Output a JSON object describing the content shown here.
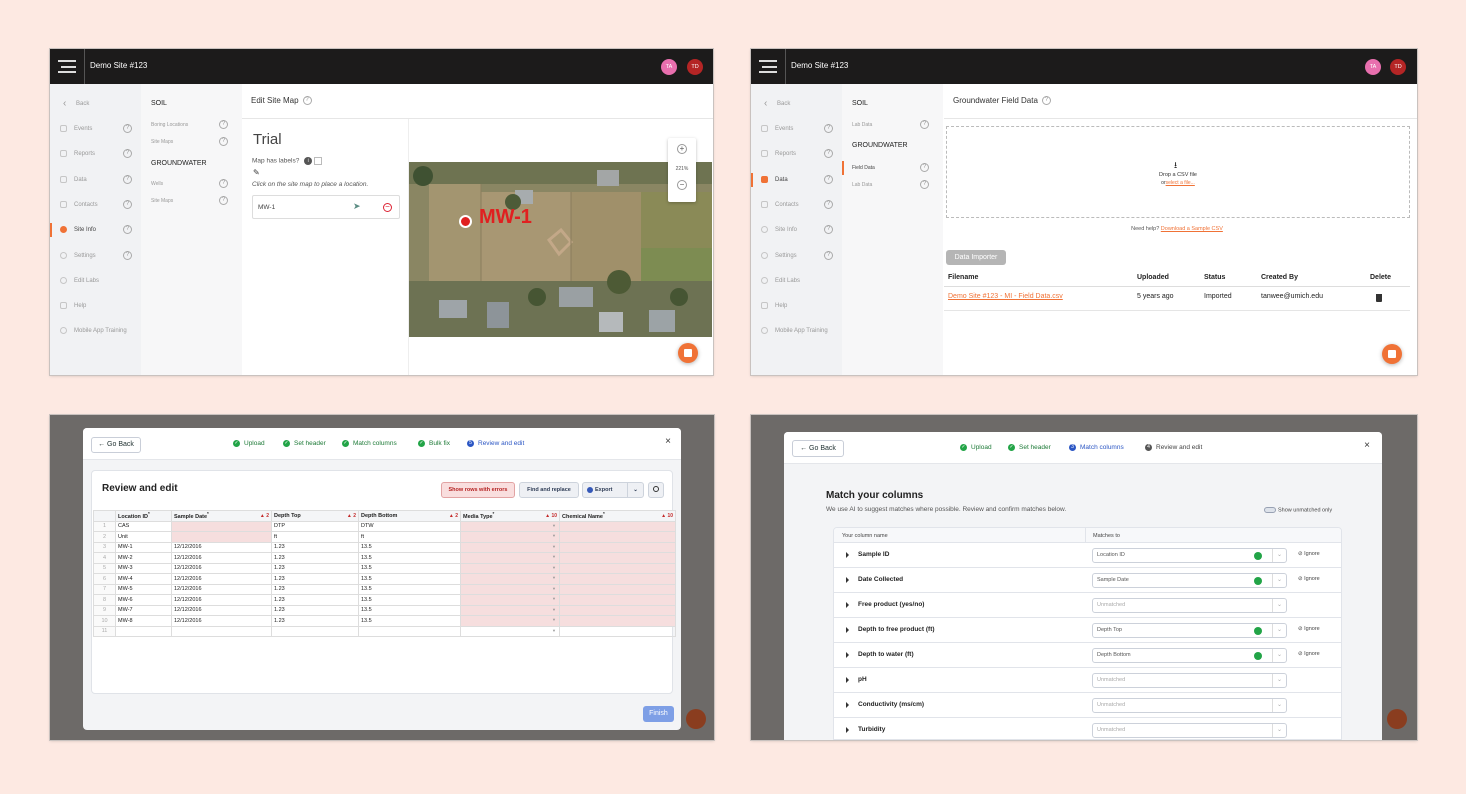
{
  "p1": {
    "site": "Demo Site #123",
    "avatars": [
      {
        "initials": "TA",
        "color": "#e86fae"
      },
      {
        "initials": "TD",
        "color": "#b42525"
      }
    ],
    "nav": [
      {
        "label": "Back"
      },
      {
        "label": "Events"
      },
      {
        "label": "Reports"
      },
      {
        "label": "Data"
      },
      {
        "label": "Contacts"
      },
      {
        "label": "Site Info",
        "active": true
      },
      {
        "label": "Settings"
      },
      {
        "label": "Edit Labs"
      },
      {
        "label": "Help"
      },
      {
        "label": "Mobile App Training"
      }
    ],
    "sub": {
      "soil": "SOIL",
      "soil_items": [
        "Boring Locations",
        "Site Maps"
      ],
      "gw": "GROUNDWATER",
      "gw_items": [
        "Wells",
        "Site Maps"
      ]
    },
    "title": "Edit Site Map",
    "map_name": "Trial",
    "labels_q": "Map has labels?",
    "instruction": "Click on the site map to place a location.",
    "location_value": "MW-1",
    "zoom": "221%",
    "zoom_in": "+",
    "zoom_out": "−",
    "marker_label": "MW-1"
  },
  "p2": {
    "site": "Demo Site #123",
    "avatars": [
      {
        "initials": "TA",
        "color": "#e86fae"
      },
      {
        "initials": "TD",
        "color": "#b42525"
      }
    ],
    "nav": [
      {
        "label": "Back"
      },
      {
        "label": "Events"
      },
      {
        "label": "Reports"
      },
      {
        "label": "Data",
        "active": true
      },
      {
        "label": "Contacts"
      },
      {
        "label": "Site Info"
      },
      {
        "label": "Settings"
      },
      {
        "label": "Edit Labs"
      },
      {
        "label": "Help"
      },
      {
        "label": "Mobile App Training"
      }
    ],
    "sub": {
      "soil": "SOIL",
      "soil_items": [
        "Lab Data"
      ],
      "gw": "GROUNDWATER",
      "gw_items": [
        "Field Data",
        "Lab Data"
      ]
    },
    "title": "Groundwater Field Data",
    "drop_text": "Drop a CSV file",
    "drop_or": "or",
    "drop_link": "select a file...",
    "help_q": "Need help?",
    "help_link": "Download a Sample CSV",
    "importer_btn": "Data Importer",
    "columns": [
      "Filename",
      "Uploaded",
      "Status",
      "Created By",
      "Delete"
    ],
    "row": {
      "filename": "Demo Site #123 - MI - Field Data.csv",
      "uploaded": "5 years ago",
      "status": "Imported",
      "created_by": "tanwee@umich.edu"
    }
  },
  "p3": {
    "go_back": "Go Back",
    "steps": [
      "Upload",
      "Set header",
      "Match columns",
      "Bulk fix",
      "Review and edit"
    ],
    "active_step_num": "5",
    "heading": "Review and edit",
    "btn_errors": "Show rows with errors",
    "btn_find": "Find and replace",
    "btn_export": "Export",
    "close": "×",
    "headers": [
      {
        "label": "Location ID",
        "req": true,
        "err": ""
      },
      {
        "label": "Sample Date",
        "req": true,
        "err": "2"
      },
      {
        "label": "Depth Top",
        "req": false,
        "err": "2"
      },
      {
        "label": "Depth Bottom",
        "req": false,
        "err": "2"
      },
      {
        "label": "Media Type",
        "req": true,
        "err": "10"
      },
      {
        "label": "Chemical Name",
        "req": true,
        "err": "10"
      }
    ],
    "rows": [
      [
        "1",
        "CAS",
        "",
        "DTP",
        "DTW",
        "",
        ""
      ],
      [
        "2",
        "Unit",
        "",
        "ft",
        "ft",
        "",
        ""
      ],
      [
        "3",
        "MW-1",
        "12/12/2016",
        "1.23",
        "13.5",
        "",
        ""
      ],
      [
        "4",
        "MW-2",
        "12/12/2016",
        "1.23",
        "13.5",
        "",
        ""
      ],
      [
        "5",
        "MW-3",
        "12/12/2016",
        "1.23",
        "13.5",
        "",
        ""
      ],
      [
        "6",
        "MW-4",
        "12/12/2016",
        "1.23",
        "13.5",
        "",
        ""
      ],
      [
        "7",
        "MW-5",
        "12/12/2016",
        "1.23",
        "13.5",
        "",
        ""
      ],
      [
        "8",
        "MW-6",
        "12/12/2016",
        "1.23",
        "13.5",
        "",
        ""
      ],
      [
        "9",
        "MW-7",
        "12/12/2016",
        "1.23",
        "13.5",
        "",
        ""
      ],
      [
        "10",
        "MW-8",
        "12/12/2016",
        "1.23",
        "13.5",
        "",
        ""
      ],
      [
        "11",
        "",
        "",
        "",
        "",
        "",
        ""
      ]
    ],
    "finish": "Finish"
  },
  "p4": {
    "go_back": "Go Back",
    "steps": [
      "Upload",
      "Set header",
      "Match columns",
      "Review and edit"
    ],
    "active_step_num": "3",
    "last_step_num": "4",
    "close": "×",
    "heading": "Match your columns",
    "desc": "We use AI to suggest matches where possible. Review and confirm matches below.",
    "toggle_label": "Show unmatched only",
    "col_your": "Your column name",
    "col_matches": "Matches to",
    "rows": [
      {
        "name": "Sample ID",
        "match": "Location ID",
        "matched": true,
        "ignore": "Ignore"
      },
      {
        "name": "Date Collected",
        "match": "Sample Date",
        "matched": true,
        "ignore": "Ignore"
      },
      {
        "name": "Free product (yes/no)",
        "match": "Unmatched",
        "matched": false,
        "ignore": ""
      },
      {
        "name": "Depth to free product (ft)",
        "match": "Depth Top",
        "matched": true,
        "ignore": "Ignore"
      },
      {
        "name": "Depth to water (ft)",
        "match": "Depth Bottom",
        "matched": true,
        "ignore": "Ignore"
      },
      {
        "name": "pH",
        "match": "Unmatched",
        "matched": false,
        "ignore": ""
      },
      {
        "name": "Conductivity (ms/cm)",
        "match": "Unmatched",
        "matched": false,
        "ignore": ""
      },
      {
        "name": "Turbidity",
        "match": "Unmatched",
        "matched": false,
        "ignore": ""
      }
    ]
  }
}
